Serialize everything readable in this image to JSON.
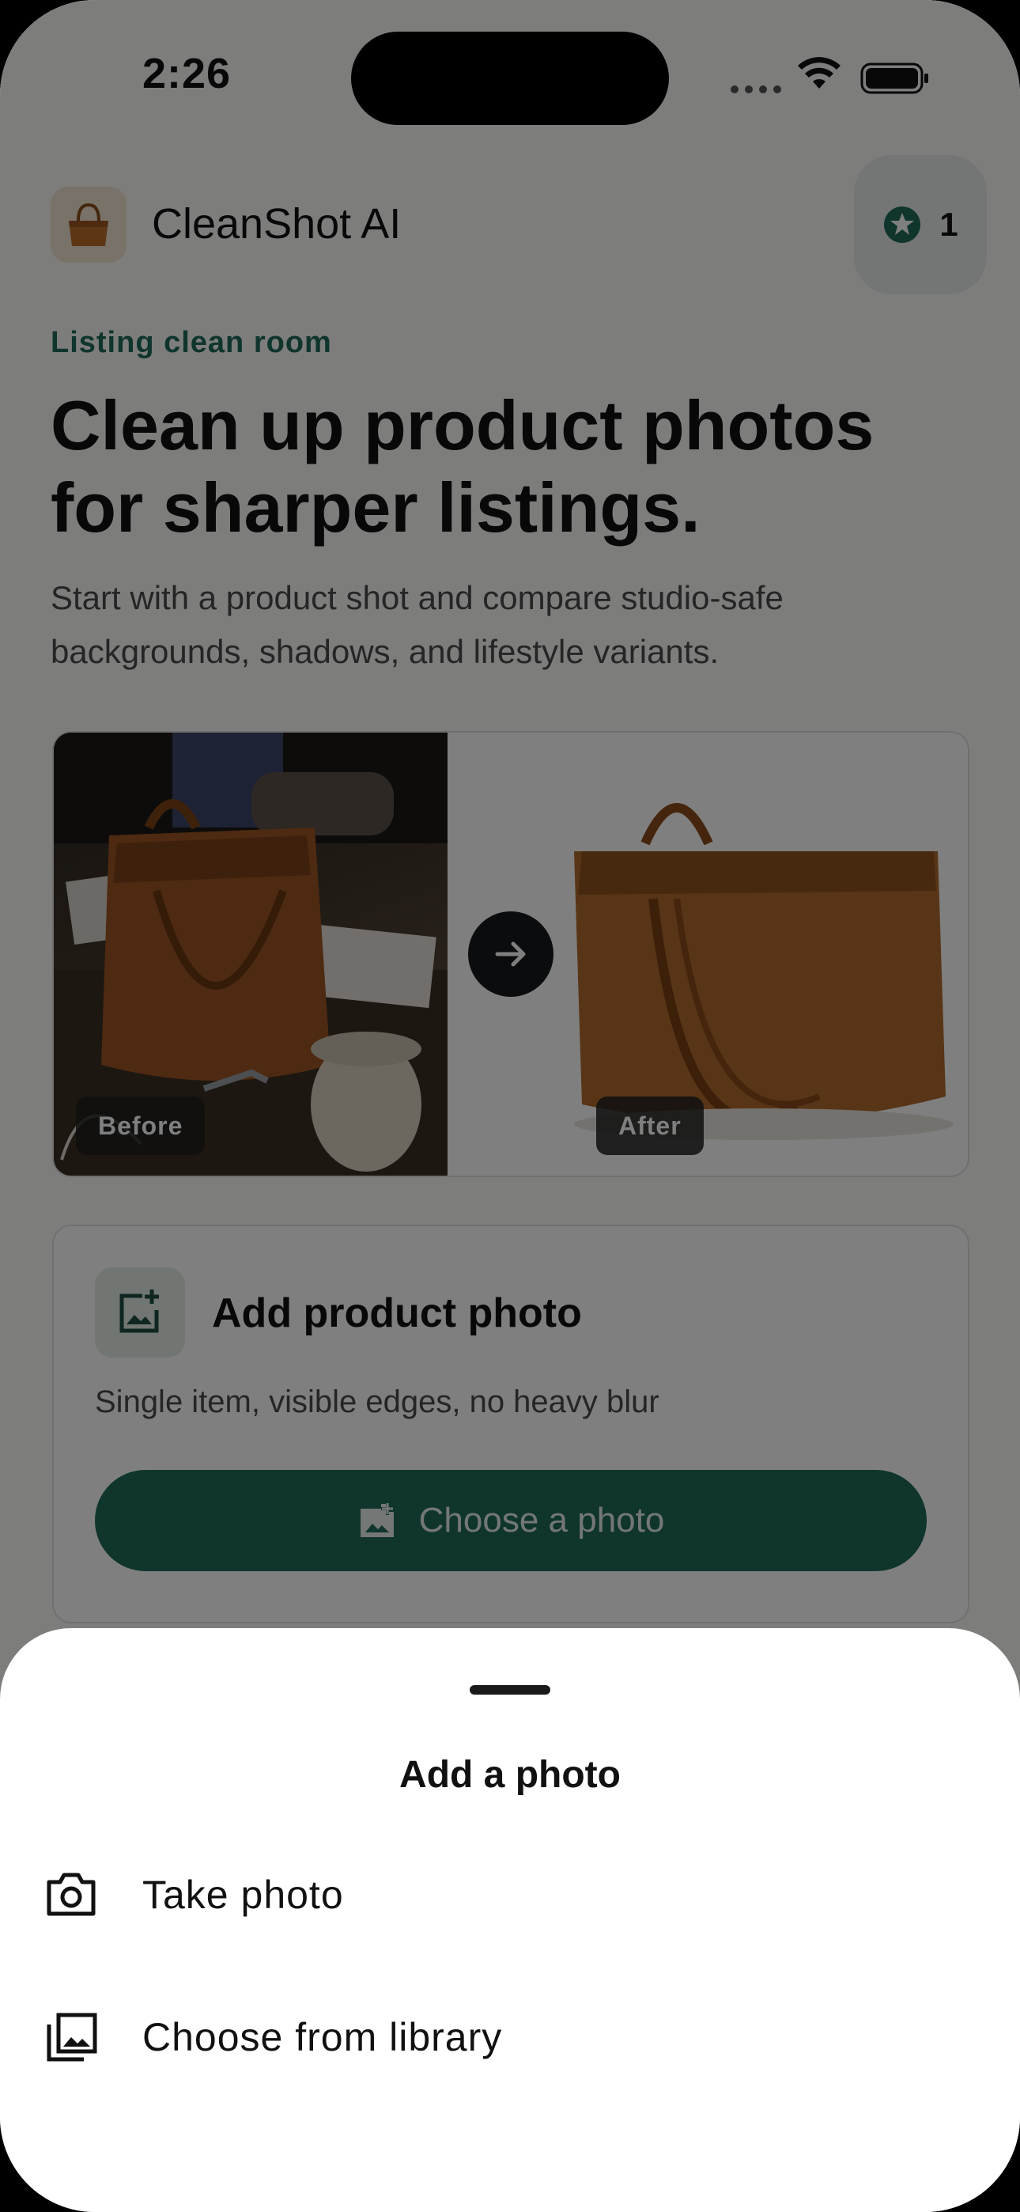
{
  "status_bar": {
    "time": "2:26"
  },
  "header": {
    "app_name": "CleanShot AI",
    "credits": "1",
    "logo_icon": "handbag-icon",
    "credits_icon": "star-badge-icon"
  },
  "hero": {
    "eyebrow": "Listing clean room",
    "headline": "Clean up product photos for sharper listings.",
    "subtitle": "Start with a product shot and compare studio-safe backgrounds, shadows, and lifestyle variants."
  },
  "compare": {
    "before_label": "Before",
    "after_label": "After",
    "arrow_icon": "arrow-right-icon"
  },
  "upload": {
    "title": "Add product photo",
    "hint": "Single item, visible edges, no heavy blur",
    "button_label": "Choose a photo",
    "icon": "add-photo-icon"
  },
  "sheet": {
    "title": "Add a photo",
    "options": [
      {
        "label": "Take photo",
        "icon": "camera-icon"
      },
      {
        "label": "Choose from library",
        "icon": "photo-library-icon"
      }
    ]
  },
  "colors": {
    "accent": "#1f6b59",
    "eyebrow": "#1e6b5a",
    "overlay": "rgba(0,0,0,0.5)"
  }
}
